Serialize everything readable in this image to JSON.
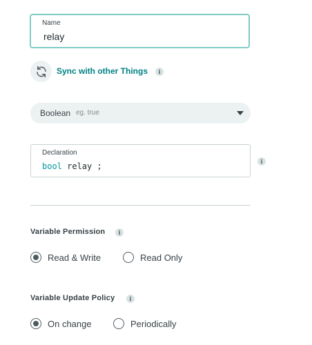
{
  "name_field": {
    "label": "Name",
    "value": "relay"
  },
  "sync": {
    "label": "Sync with other Things",
    "icon": "sync-icon",
    "info": "i"
  },
  "type_select": {
    "value": "Boolean",
    "hint": "eg. true"
  },
  "declaration": {
    "label": "Declaration",
    "keyword": "bool",
    "code": " relay ;",
    "info": "i"
  },
  "permission": {
    "title": "Variable Permission",
    "info": "i",
    "options": [
      {
        "label": "Read & Write",
        "checked": true
      },
      {
        "label": "Read Only",
        "checked": false
      }
    ]
  },
  "update_policy": {
    "title": "Variable Update Policy",
    "info": "i",
    "options": [
      {
        "label": "On change",
        "checked": true
      },
      {
        "label": "Periodically",
        "checked": false
      }
    ]
  },
  "colors": {
    "accent": "#008184",
    "focus_border": "#7fcbc4",
    "select_bg": "#ecf1f1"
  }
}
